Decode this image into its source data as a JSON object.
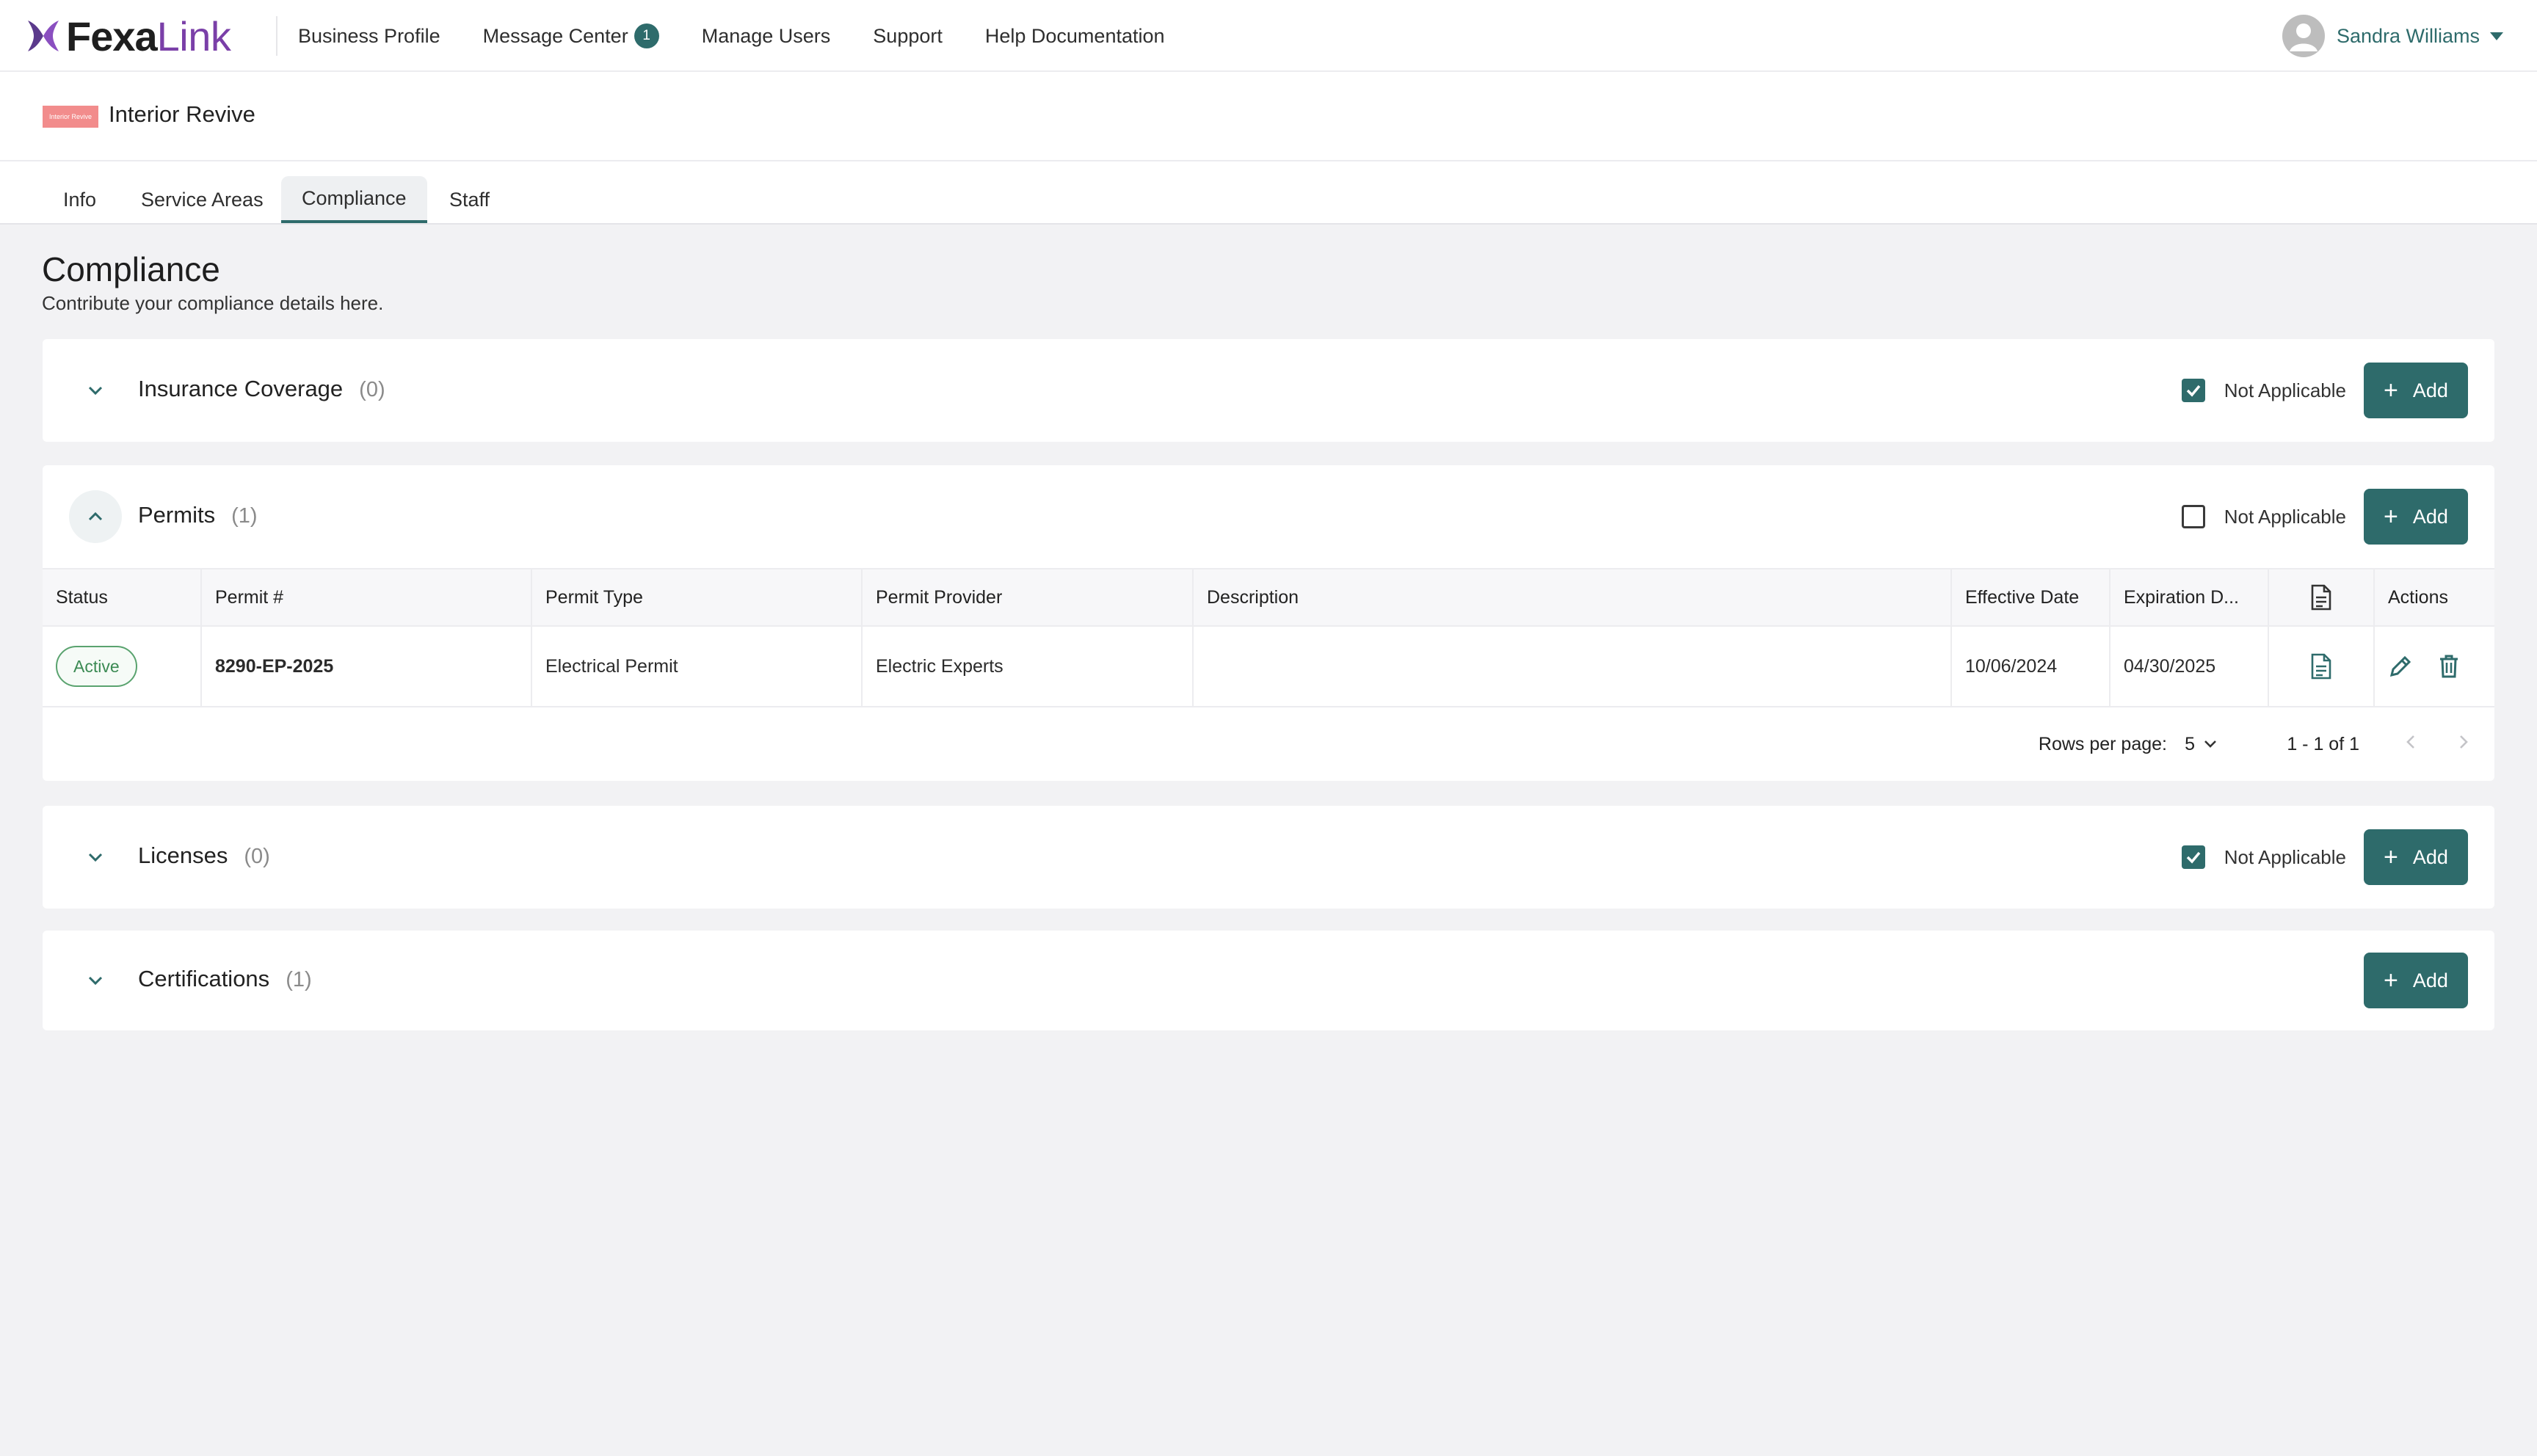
{
  "brand": {
    "name_bold": "Fexa",
    "name_light": "Link"
  },
  "nav": {
    "items": [
      {
        "label": "Business Profile"
      },
      {
        "label": "Message Center",
        "badge": "1"
      },
      {
        "label": "Manage Users"
      },
      {
        "label": "Support"
      },
      {
        "label": "Help Documentation"
      }
    ],
    "user": {
      "name": "Sandra Williams",
      "icon": "user-avatar-icon"
    }
  },
  "business": {
    "name": "Interior Revive",
    "logo_text": "Interior Revive"
  },
  "tabs": [
    {
      "label": "Info"
    },
    {
      "label": "Service Areas"
    },
    {
      "label": "Compliance",
      "active": true
    },
    {
      "label": "Staff"
    }
  ],
  "page": {
    "title": "Compliance",
    "subtitle": "Contribute your compliance details here."
  },
  "sections": {
    "insurance": {
      "title": "Insurance Coverage",
      "count": "(0)",
      "na_label": "Not Applicable",
      "na_checked": true,
      "add_label": "Add",
      "expanded": false
    },
    "permits": {
      "title": "Permits",
      "count": "(1)",
      "na_label": "Not Applicable",
      "na_checked": false,
      "add_label": "Add",
      "expanded": true
    },
    "licenses": {
      "title": "Licenses",
      "count": "(0)",
      "na_label": "Not Applicable",
      "na_checked": true,
      "add_label": "Add",
      "expanded": false
    },
    "certifications": {
      "title": "Certifications",
      "count": "(1)",
      "add_label": "Add",
      "expanded": false
    }
  },
  "permits_table": {
    "headers": {
      "status": "Status",
      "permit_no": "Permit #",
      "permit_type": "Permit Type",
      "permit_provider": "Permit Provider",
      "description": "Description",
      "effective_date": "Effective Date",
      "expiration_date": "Expiration D...",
      "document": "document-icon",
      "actions": "Actions"
    },
    "rows": [
      {
        "status": "Active",
        "permit_no": "8290-EP-2025",
        "permit_type": "Electrical Permit",
        "permit_provider": "Electric Experts",
        "description": "",
        "effective_date": "10/06/2024",
        "expiration_date": "04/30/2025"
      }
    ],
    "pagination": {
      "rows_per_page_label": "Rows per page:",
      "rows_per_page": "5",
      "range": "1 - 1 of 1"
    }
  },
  "colors": {
    "accent": "#2e6b6b",
    "brand_purple": "#7a3fa8",
    "active_green": "#3b8a53"
  }
}
